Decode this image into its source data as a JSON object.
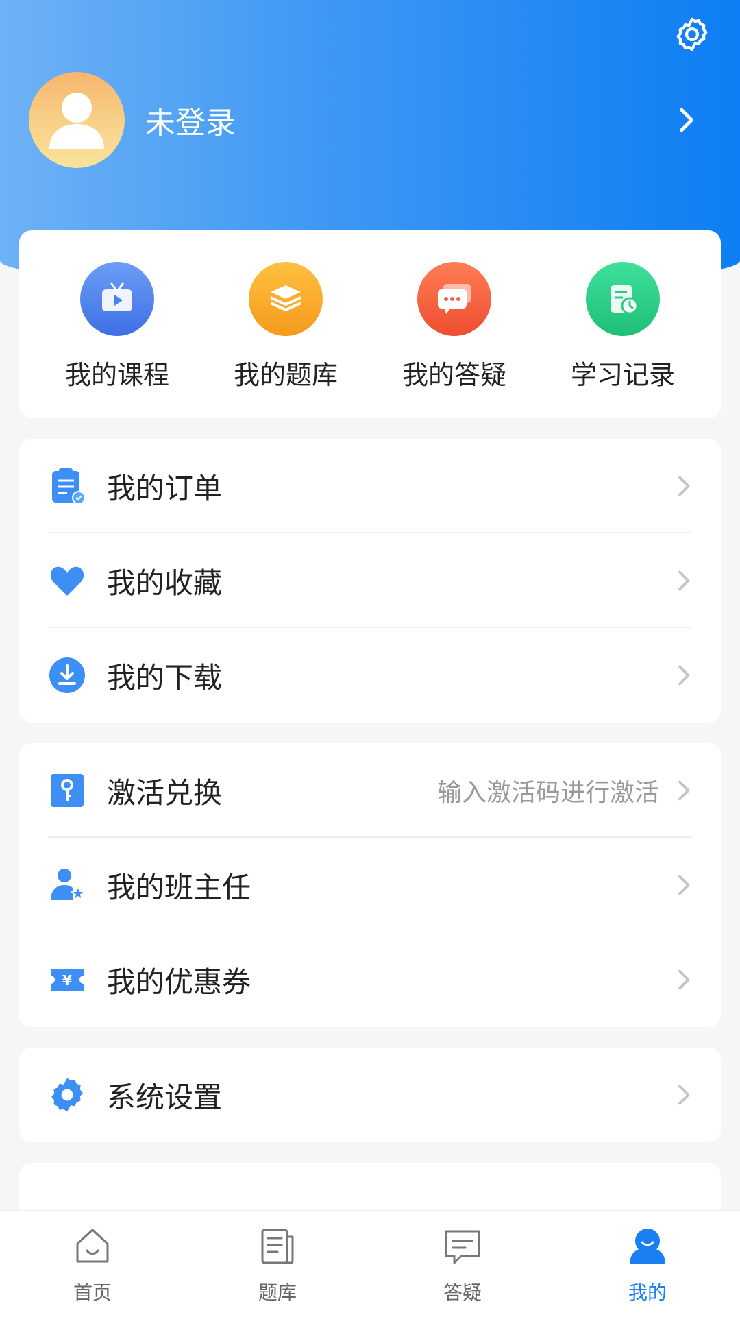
{
  "header": {
    "login_status": "未登录"
  },
  "quick_actions": [
    {
      "label": "我的课程",
      "icon": "tv-play-icon",
      "color": "#4e86ef"
    },
    {
      "label": "我的题库",
      "icon": "stack-icon",
      "color": "#f6a824"
    },
    {
      "label": "我的答疑",
      "icon": "chat-icon",
      "color": "#f2643f"
    },
    {
      "label": "学习记录",
      "icon": "record-clock-icon",
      "color": "#2fcc86"
    }
  ],
  "menu_group_1": [
    {
      "label": "我的订单",
      "icon": "order-icon"
    },
    {
      "label": "我的收藏",
      "icon": "heart-icon"
    },
    {
      "label": "我的下载",
      "icon": "download-icon"
    }
  ],
  "menu_group_2": [
    {
      "label": "激活兑换",
      "hint": "输入激活码进行激活",
      "icon": "key-icon"
    },
    {
      "label": "我的班主任",
      "icon": "teacher-icon"
    },
    {
      "label": "我的优惠券",
      "icon": "coupon-icon"
    }
  ],
  "menu_group_3": [
    {
      "label": "系统设置",
      "icon": "gear-icon"
    }
  ],
  "tabbar": [
    {
      "label": "首页",
      "icon": "home-icon",
      "active": false
    },
    {
      "label": "题库",
      "icon": "question-bank-icon",
      "active": false
    },
    {
      "label": "答疑",
      "icon": "qa-icon",
      "active": false
    },
    {
      "label": "我的",
      "icon": "profile-icon",
      "active": true
    }
  ],
  "colors": {
    "accent": "#1a7ff0",
    "header_start": "#6eb2f5",
    "header_end": "#0d7ef3"
  }
}
